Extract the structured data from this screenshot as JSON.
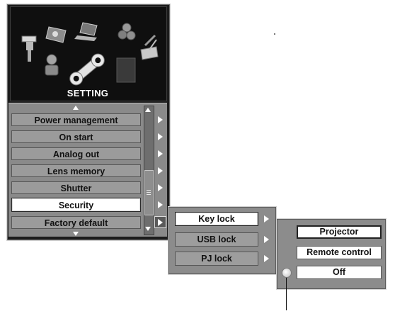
{
  "main_menu": {
    "title": "SETTING",
    "items": [
      {
        "label": "Power management",
        "selected": false
      },
      {
        "label": "On start",
        "selected": false
      },
      {
        "label": "Analog out",
        "selected": false
      },
      {
        "label": "Lens memory",
        "selected": false
      },
      {
        "label": "Shutter",
        "selected": false
      },
      {
        "label": "Security",
        "selected": true
      },
      {
        "label": "Factory default",
        "selected": false
      }
    ]
  },
  "security_submenu": {
    "items": [
      {
        "label": "Key lock",
        "selected": true
      },
      {
        "label": "USB lock",
        "selected": false
      },
      {
        "label": "PJ lock",
        "selected": false
      }
    ]
  },
  "key_lock_options": {
    "items": [
      {
        "label": "Projector",
        "selected": true
      },
      {
        "label": "Remote control",
        "selected": false
      },
      {
        "label": "Off",
        "selected": false
      }
    ]
  },
  "icons": [
    "settings-category-icons",
    "wrench-icon"
  ],
  "colors": {
    "panel_bg": "#1c1c1c",
    "item_bg": "#9b9b9b",
    "selected_bg": "#ffffff"
  }
}
